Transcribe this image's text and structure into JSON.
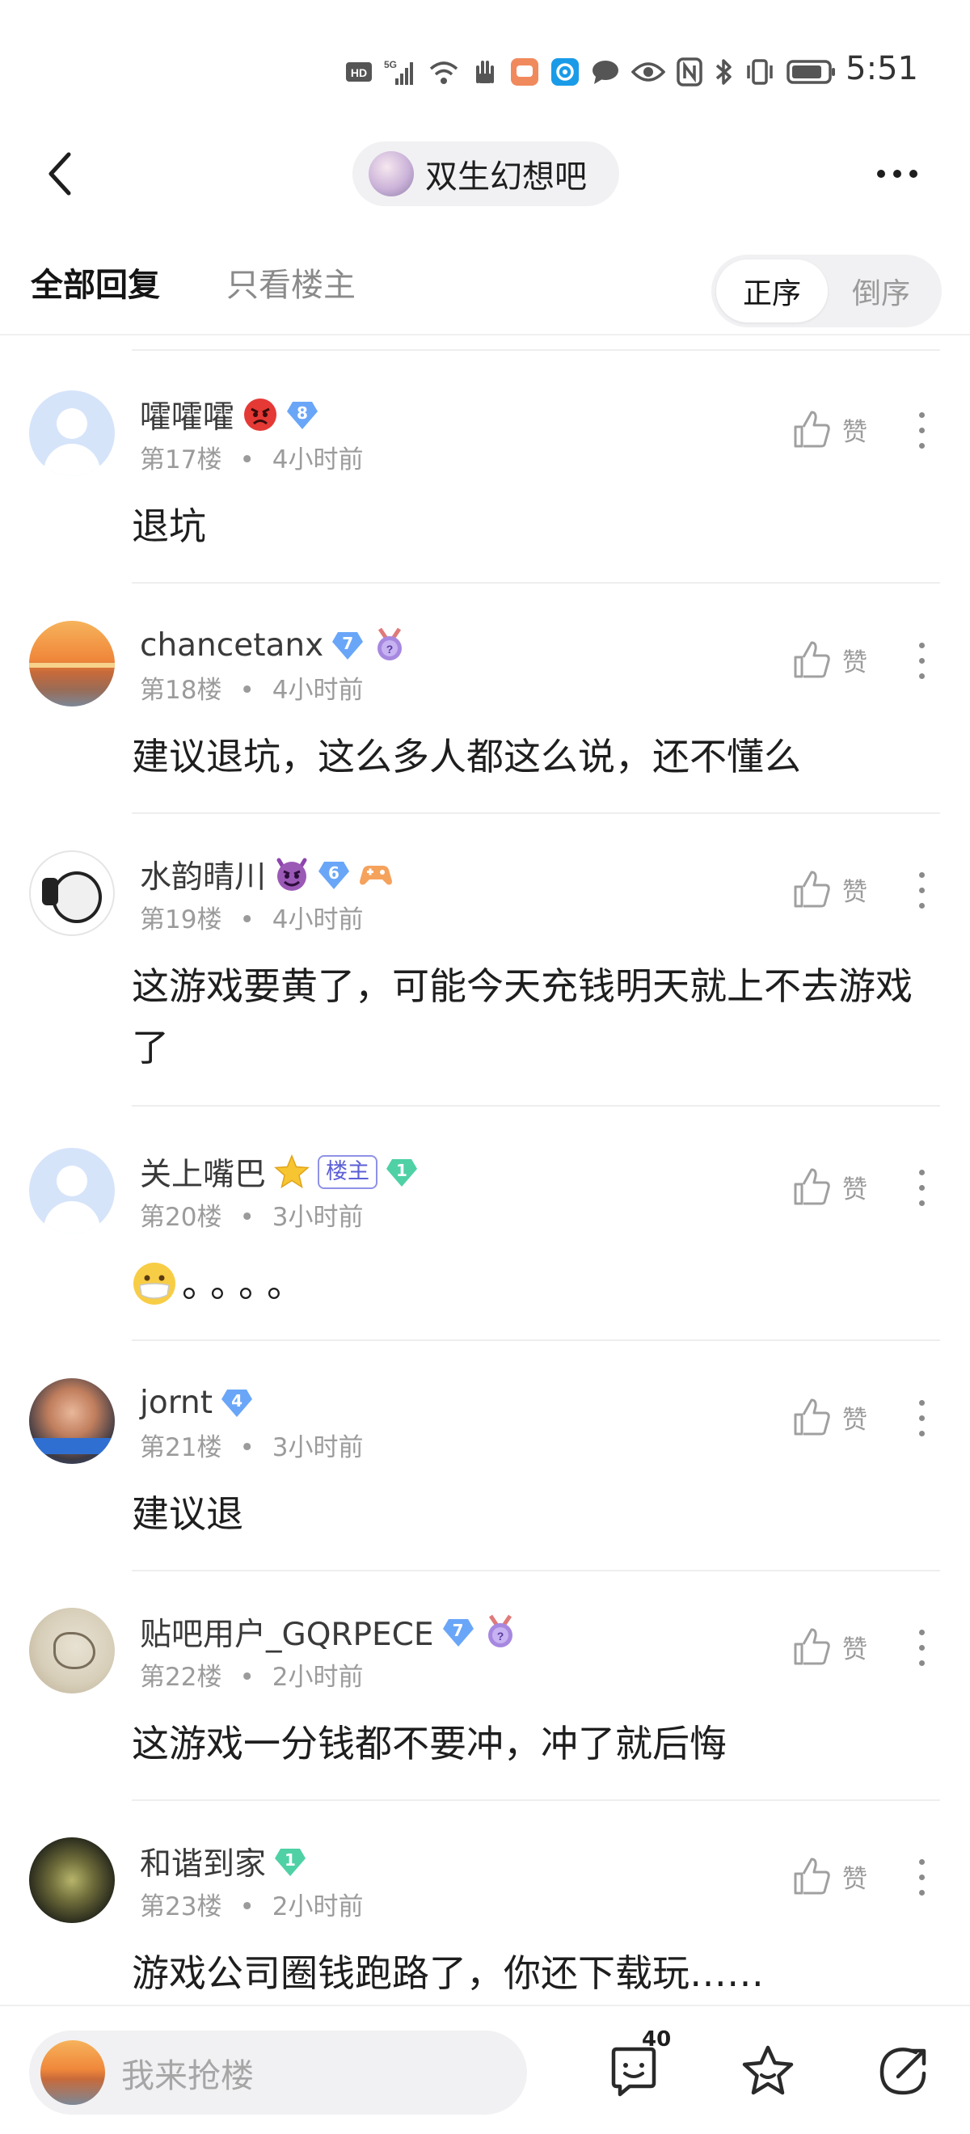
{
  "status_bar": {
    "time": "5:51",
    "network_label": "HD",
    "network_type": "5G",
    "icons": [
      "hd-icon",
      "signal-5g-icon",
      "wifi-icon",
      "hand-icon",
      "chat-app-icon",
      "browser-icon",
      "message-icon",
      "eye-icon",
      "nfc-icon",
      "bluetooth-icon",
      "vibrate-icon",
      "battery-icon"
    ]
  },
  "header": {
    "forum_name": "双生幻想吧"
  },
  "tabs": {
    "all": "全部回复",
    "owner_only": "只看楼主",
    "sort_asc": "正序",
    "sort_desc": "倒序"
  },
  "comments": [
    {
      "username": "嚯嚯嚯",
      "name_emoji": "angry-face-emoji",
      "level": "8",
      "floor": "第17楼",
      "time": "4小时前",
      "like": "赞",
      "text": "退坑"
    },
    {
      "username": "chancetanx",
      "level": "7",
      "badge": "purple-medal-icon",
      "floor": "第18楼",
      "time": "4小时前",
      "like": "赞",
      "text": "建议退坑，这么多人都这么说，还不懂么"
    },
    {
      "username": "水韵晴川",
      "name_emoji": "devil-face-emoji",
      "level": "6",
      "badge": "game-controller-icon",
      "floor": "第19楼",
      "time": "4小时前",
      "like": "赞",
      "text": "这游戏要黄了，可能今天充钱明天就上不去游戏了"
    },
    {
      "username": "关上嘴巴",
      "name_emoji": "star-emoji",
      "owner_tag": "楼主",
      "level": "1",
      "floor": "第20楼",
      "time": "3小时前",
      "like": "赞",
      "text": "。。。。",
      "text_emoji": "mask-face-emoji"
    },
    {
      "username": "jornt",
      "level": "4",
      "floor": "第21楼",
      "time": "3小时前",
      "like": "赞",
      "text": "建议退"
    },
    {
      "username": "贴吧用户_GQRPECE",
      "level": "7",
      "badge": "purple-medal-icon",
      "floor": "第22楼",
      "time": "2小时前",
      "like": "赞",
      "text": "这游戏一分钱都不要冲，冲了就后悔"
    },
    {
      "username": "和谐到家",
      "level": "1",
      "floor": "第23楼",
      "time": "2小时前",
      "like": "赞",
      "text": "游戏公司圈钱跑路了，你还下载玩……"
    }
  ],
  "bottom_bar": {
    "reply_placeholder": "我来抢楼",
    "reply_count": "40"
  },
  "colors": {
    "badge_blue": "#6aa6f8",
    "badge_green": "#4fd1a5",
    "owner_tag": "#5b5fd6",
    "text_primary": "#1e1e1e",
    "text_secondary": "#9b9b9b"
  }
}
